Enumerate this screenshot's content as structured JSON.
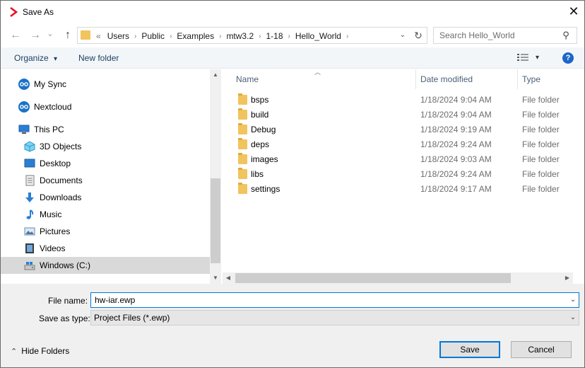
{
  "window": {
    "title": "Save As",
    "close_glyph": "✕",
    "app_icon": "chevron-right-icon",
    "accent": "#e81123"
  },
  "nav_buttons": {
    "back": "←",
    "forward": "→",
    "recent": "⌄",
    "up": "↑"
  },
  "address": {
    "overflow": "«",
    "crumbs": [
      "Users",
      "Public",
      "Examples",
      "mtw3.2",
      "1-18",
      "Hello_World"
    ],
    "separator": "›",
    "dropdown": "⌄",
    "refresh": "↻"
  },
  "search": {
    "placeholder": "Search Hello_World",
    "icon": "⚲"
  },
  "toolbar": {
    "organize": "Organize",
    "organize_caret": "▾",
    "new_folder": "New folder",
    "view_caret": "▾"
  },
  "help": {
    "glyph": "?"
  },
  "nav_pane": {
    "items": [
      {
        "label": "My Sync",
        "icon": "nextcloud-icon"
      },
      {
        "label": "Nextcloud",
        "icon": "nextcloud-icon"
      },
      {
        "label": "This PC",
        "icon": "computer-icon"
      },
      {
        "label": "3D Objects",
        "icon": "3d-objects-icon"
      },
      {
        "label": "Desktop",
        "icon": "desktop-icon"
      },
      {
        "label": "Documents",
        "icon": "documents-icon"
      },
      {
        "label": "Downloads",
        "icon": "downloads-icon"
      },
      {
        "label": "Music",
        "icon": "music-icon"
      },
      {
        "label": "Pictures",
        "icon": "pictures-icon"
      },
      {
        "label": "Videos",
        "icon": "videos-icon"
      },
      {
        "label": "Windows (C:)",
        "icon": "drive-icon"
      }
    ],
    "selected": "Windows (C:)"
  },
  "file_list": {
    "columns": {
      "name": "Name",
      "date": "Date modified",
      "type": "Type"
    },
    "sort_glyph": "︿",
    "rows": [
      {
        "name": "bsps",
        "date": "1/18/2024 9:04 AM",
        "type": "File folder"
      },
      {
        "name": "build",
        "date": "1/18/2024 9:04 AM",
        "type": "File folder"
      },
      {
        "name": "Debug",
        "date": "1/18/2024 9:19 AM",
        "type": "File folder"
      },
      {
        "name": "deps",
        "date": "1/18/2024 9:24 AM",
        "type": "File folder"
      },
      {
        "name": "images",
        "date": "1/18/2024 9:03 AM",
        "type": "File folder"
      },
      {
        "name": "libs",
        "date": "1/18/2024 9:24 AM",
        "type": "File folder"
      },
      {
        "name": "settings",
        "date": "1/18/2024 9:17 AM",
        "type": "File folder"
      }
    ]
  },
  "scroll": {
    "up": "▲",
    "down": "▼",
    "left": "◀",
    "right": "▶"
  },
  "form": {
    "file_name_label": "File name:",
    "file_name_value": "hw-iar.ewp",
    "save_type_label": "Save as type:",
    "save_type_value": "Project Files (*.ewp)",
    "dropdown": "⌄"
  },
  "footer": {
    "hide_folders": "Hide Folders",
    "hide_caret": "⌃",
    "save": "Save",
    "cancel": "Cancel"
  }
}
